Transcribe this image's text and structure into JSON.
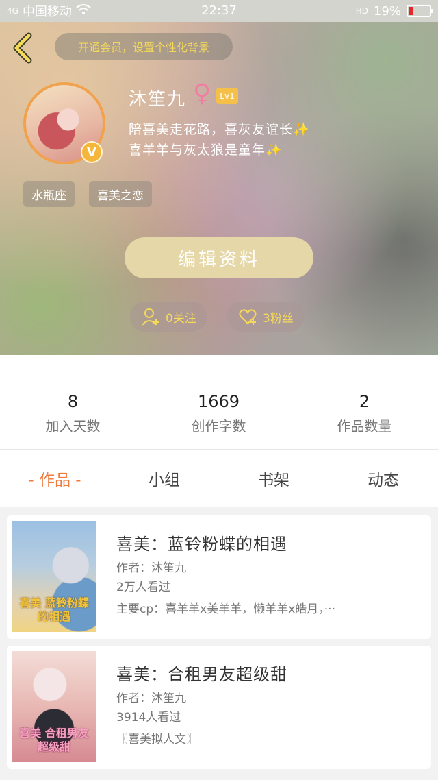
{
  "status_bar": {
    "signal": "4G",
    "carrier": "中国移动",
    "time": "22:37",
    "call_icon": "HD",
    "battery": "19%",
    "battery_level": 0.19
  },
  "profile": {
    "vip_banner": "开通会员，设置个性化背景",
    "username": "沐笙九",
    "gender_symbol": "♀",
    "level": "Lv1",
    "vip_badge": "V",
    "bio_line1": "陪喜美走花路，喜灰友谊长✨",
    "bio_line2": "喜羊羊与灰太狼是童年✨",
    "tags": [
      "水瓶座",
      "喜美之恋"
    ],
    "edit_button": "编辑资料",
    "following": "0关注",
    "fans": "3粉丝"
  },
  "stats": [
    {
      "value": "8",
      "label": "加入天数"
    },
    {
      "value": "1669",
      "label": "创作字数"
    },
    {
      "value": "2",
      "label": "作品数量"
    }
  ],
  "tabs": [
    "- 作品 -",
    "小组",
    "书架",
    "动态"
  ],
  "books": [
    {
      "title": "喜美：蓝铃粉蝶的相遇",
      "author": "作者：沐笙九",
      "views": "2万人看过",
      "extra": "主要cp：喜羊羊x美羊羊，懒羊羊x皓月，···",
      "cover_text": "喜美 蓝铃粉蝶 的相遇"
    },
    {
      "title": "喜美：合租男友超级甜",
      "author": "作者：沐笙九",
      "views": "3914人看过",
      "extra": "〖喜美拟人文〗",
      "cover_text": "喜美 合租男友 超级甜"
    }
  ],
  "colors": {
    "accent": "#f07a3c",
    "gold": "#f5d95a",
    "edit_button": "#e6d7a8"
  }
}
